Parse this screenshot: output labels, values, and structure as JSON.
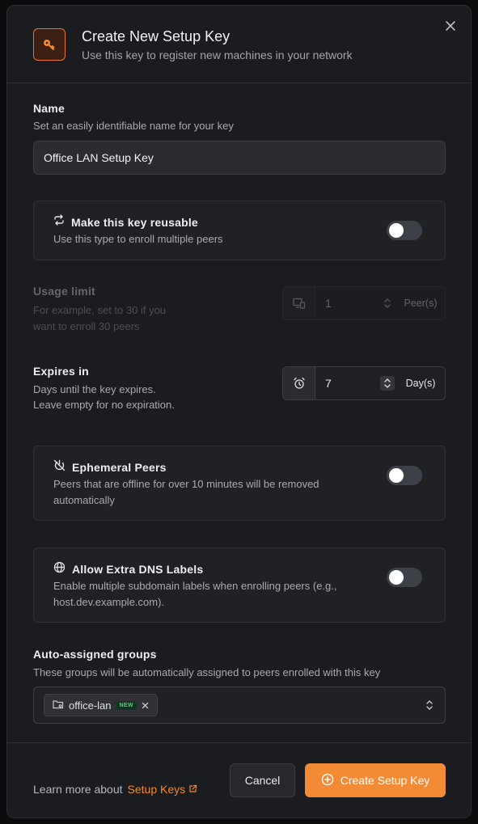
{
  "header": {
    "title": "Create New Setup Key",
    "subtitle": "Use this key to register new machines in your network",
    "icon": "key-icon",
    "accent": "#f28a36"
  },
  "name": {
    "label": "Name",
    "help": "Set an easily identifiable name for your key",
    "value": "Office LAN Setup Key"
  },
  "reusable": {
    "label": "Make this key reusable",
    "help": "Use this type to enroll multiple peers",
    "icon": "repeat-icon",
    "enabled": false
  },
  "usage_limit": {
    "label": "Usage limit",
    "help_line1": "For example, set to 30 if you",
    "help_line2": "want to enroll 30 peers",
    "value": "1",
    "unit": "Peer(s)",
    "disabled": true
  },
  "expires": {
    "label": "Expires in",
    "help_line1": "Days until the key expires.",
    "help_line2": "Leave empty for no expiration.",
    "value": "7",
    "unit": "Day(s)"
  },
  "ephemeral": {
    "label": "Ephemeral Peers",
    "help": "Peers that are offline for over 10 minutes will be removed automatically",
    "icon": "power-off-icon",
    "enabled": false
  },
  "dns_labels": {
    "label": "Allow Extra DNS Labels",
    "help": "Enable multiple subdomain labels when enrolling peers (e.g., host.dev.example.com).",
    "icon": "globe-icon",
    "enabled": false
  },
  "groups": {
    "label": "Auto-assigned groups",
    "help": "These groups will be automatically assigned to peers enrolled with this key",
    "chips": [
      {
        "label": "office-lan",
        "badge": "NEW"
      }
    ]
  },
  "footer": {
    "learn_text": "Learn more about",
    "learn_link": "Setup Keys",
    "cancel_label": "Cancel",
    "create_label": "Create Setup Key"
  }
}
